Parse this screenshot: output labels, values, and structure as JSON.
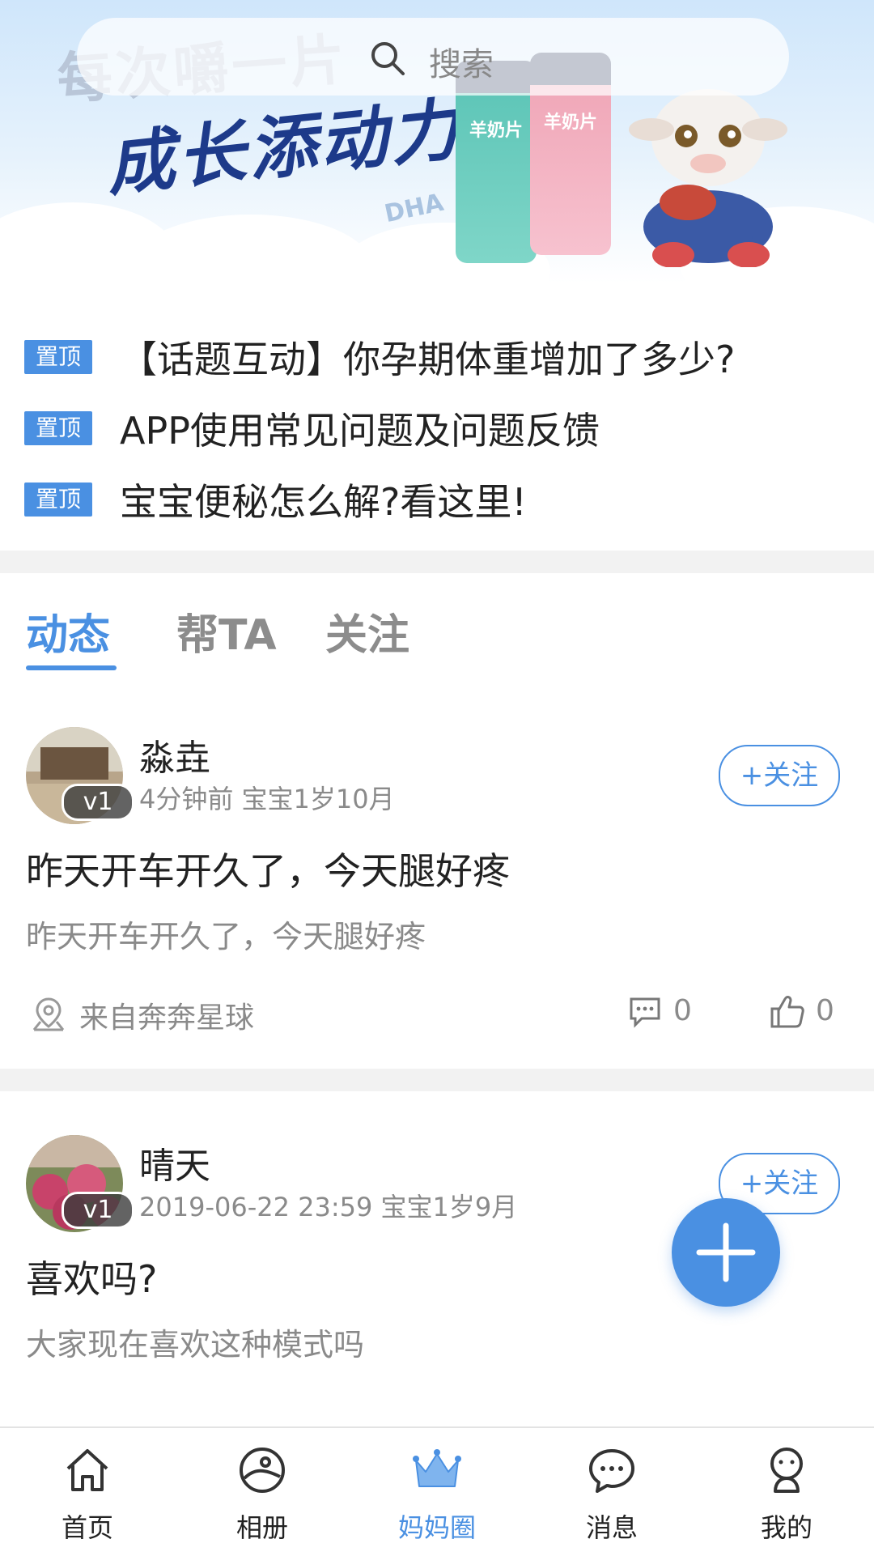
{
  "banner": {
    "headline_top": "每次嚼一片",
    "headline_main": "成长添动力",
    "product_left": "羊奶片",
    "product_right": "羊奶片",
    "watermark": "DHA"
  },
  "search": {
    "placeholder": "搜索"
  },
  "pinned": {
    "badge": "置顶",
    "items": [
      "【话题互动】你孕期体重增加了多少?",
      "APP使用常见问题及问题反馈",
      "宝宝便秘怎么解?看这里!"
    ]
  },
  "tabs": [
    {
      "label": "动态",
      "active": true
    },
    {
      "label": "帮TA",
      "active": false
    },
    {
      "label": "关注",
      "active": false
    }
  ],
  "posts": [
    {
      "username": "淼垚",
      "level": "v1",
      "time": "4分钟前",
      "baby_age": "宝宝1岁10月",
      "follow_label": "+关注",
      "title": "昨天开车开久了，今天腿好疼",
      "body": "昨天开车开久了，今天腿好疼",
      "location": "来自奔奔星球",
      "comments": "0",
      "likes": "0"
    },
    {
      "username": "晴天",
      "level": "v1",
      "time": "2019-06-22 23:59",
      "baby_age": "宝宝1岁9月",
      "follow_label": "+关注",
      "title": "喜欢吗?",
      "body": "大家现在喜欢这种模式吗"
    }
  ],
  "fab_icon": "plus-icon",
  "bottom_nav": [
    {
      "label": "首页",
      "icon": "home-icon",
      "active": false
    },
    {
      "label": "相册",
      "icon": "album-icon",
      "active": false
    },
    {
      "label": "妈妈圈",
      "icon": "crown-icon",
      "active": true
    },
    {
      "label": "消息",
      "icon": "chat-icon",
      "active": false
    },
    {
      "label": "我的",
      "icon": "profile-icon",
      "active": false
    }
  ],
  "colors": {
    "accent": "#4a90e2",
    "text": "#222222",
    "muted": "#8a8a8a",
    "separator": "#f2f2f2"
  }
}
